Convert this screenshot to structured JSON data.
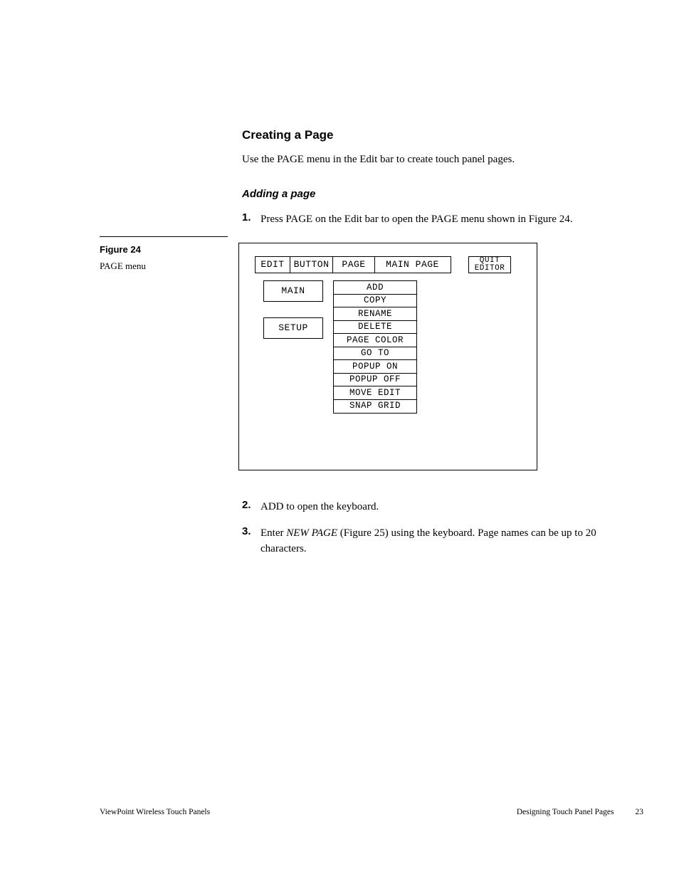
{
  "heading": "Creating a Page",
  "intro": "Use the PAGE menu in the Edit bar to create touch panel pages.",
  "subheading": "Adding a page",
  "steps": [
    {
      "num": "1.",
      "text": "Press PAGE on the Edit bar to open the PAGE menu shown in Figure 24."
    },
    {
      "num": "2.",
      "text": "ADD to open the keyboard."
    },
    {
      "num": "3.",
      "prefix": "Enter ",
      "emph": "NEW PAGE",
      "suffix": " (Figure 25) using the keyboard. Page names can be up to 20 characters."
    }
  ],
  "sidebar": {
    "figlabel": "Figure 24",
    "caption": "PAGE menu"
  },
  "panel": {
    "top": {
      "edit": "EDIT",
      "button": "BUTTON",
      "page": "PAGE",
      "mainpage": "MAIN PAGE",
      "quit_l1": "QUIT",
      "quit_l2": "EDITOR"
    },
    "left": {
      "main": "MAIN",
      "setup": "SETUP"
    },
    "menu": [
      "ADD",
      "COPY",
      "RENAME",
      "DELETE",
      "PAGE COLOR",
      "GO TO",
      "POPUP ON",
      "POPUP OFF",
      "MOVE EDIT",
      "SNAP GRID"
    ]
  },
  "footer": {
    "left": "ViewPoint Wireless Touch Panels",
    "right_title": "Designing Touch Panel Pages",
    "page": "23"
  }
}
